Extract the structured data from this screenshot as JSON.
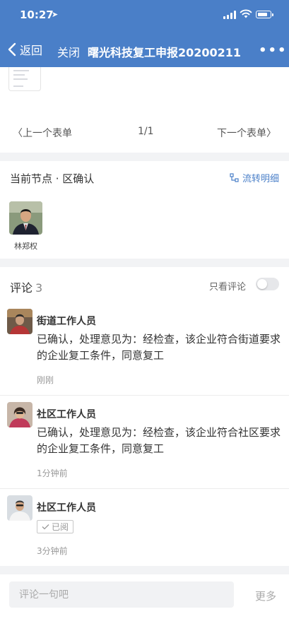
{
  "status_bar": {
    "time": "10:27",
    "location_glyph": "➤"
  },
  "navbar": {
    "back_label": "返回",
    "close_label": "关闭",
    "title": "曙光科技复工申报20200211",
    "more_label": "•••"
  },
  "pager": {
    "prev_label": "上一个表单",
    "page": "1/1",
    "next_label": "下一个表单",
    "prev_arrow": "〈",
    "next_arrow": "〉"
  },
  "node": {
    "title": "当前节点 · 区确认",
    "flow_label": "流转明细",
    "assignee_name": "林郑权"
  },
  "comments": {
    "label": "评论",
    "count": "3",
    "only_label": "只看评论",
    "only_enabled": false,
    "items": [
      {
        "author": "街道工作人员",
        "text": "已确认，处理意见为：经检查，该企业符合街道要求的企业复工条件，同意复工",
        "time": "刚刚"
      },
      {
        "author": "社区工作人员",
        "text": "已确认，处理意见为：经检查，该企业符合社区要求的企业复工条件，同意复工",
        "time": "1分钟前"
      },
      {
        "author": "社区工作人员",
        "tag": "已阅",
        "time": "3分钟前"
      }
    ]
  },
  "input": {
    "placeholder": "评论一句吧",
    "value": ""
  },
  "more_label": "更多",
  "colors": {
    "primary": "#4a7fc8",
    "background": "#f2f3f5",
    "muted": "#999999"
  }
}
